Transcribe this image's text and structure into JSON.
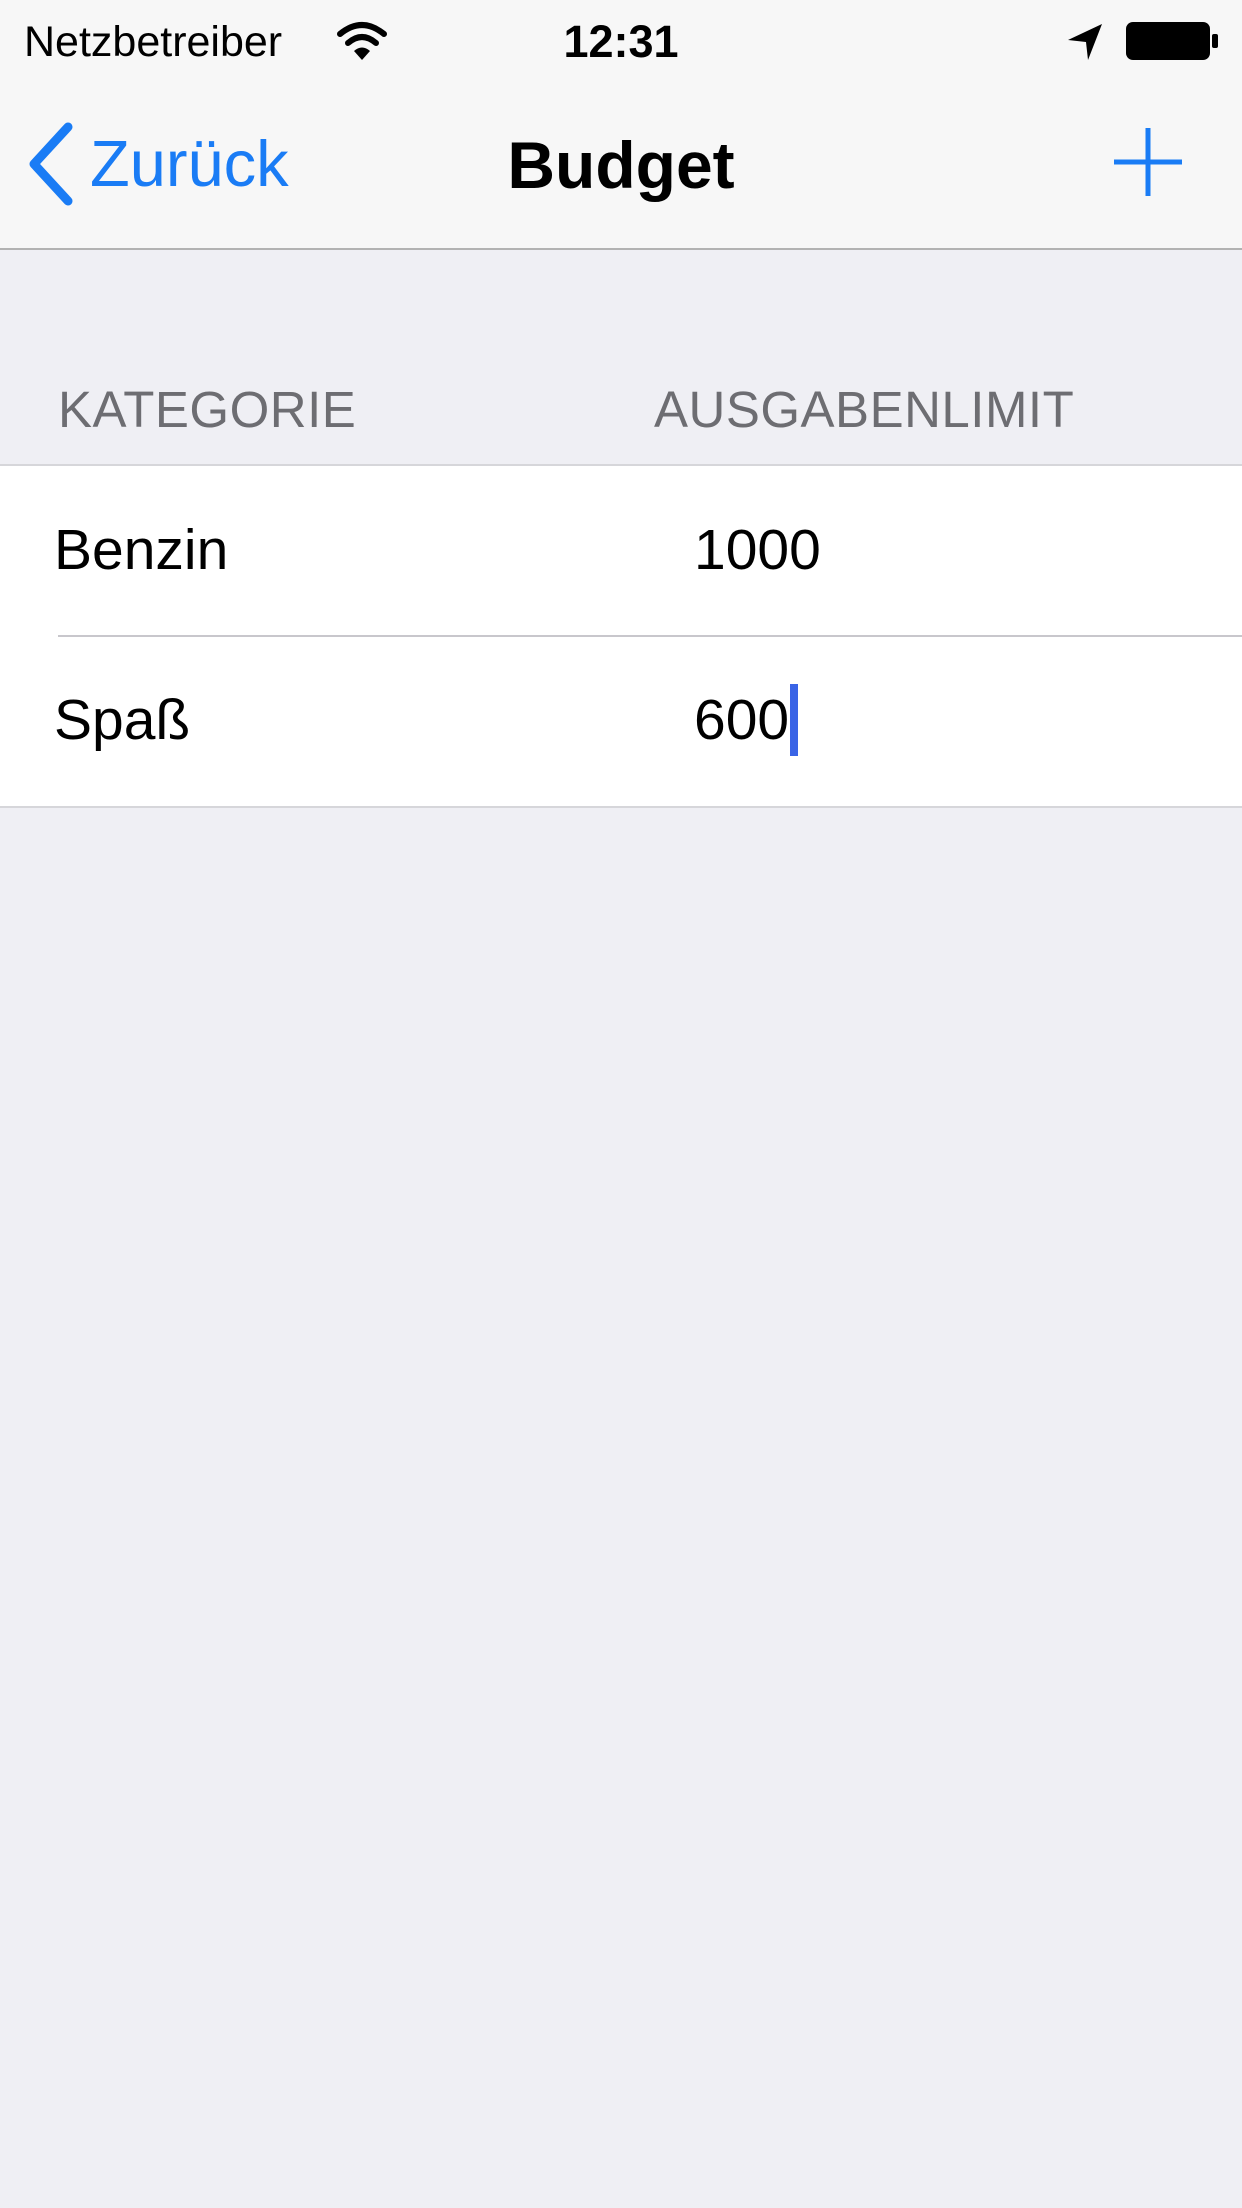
{
  "status_bar": {
    "carrier": "Netzbetreiber",
    "time": "12:31",
    "icons": [
      "wifi-icon",
      "location-arrow-icon",
      "battery-icon"
    ]
  },
  "nav_bar": {
    "back_label": "Zurück",
    "title": "Budget",
    "back_icon": "chevron-left-icon",
    "add_icon": "plus-icon"
  },
  "table": {
    "headers": [
      "KATEGORIE",
      "AUSGABENLIMIT"
    ],
    "rows": [
      {
        "category": "Benzin",
        "limit": "1000"
      },
      {
        "category": "Spaß",
        "limit": "600"
      }
    ],
    "active_row": 1
  },
  "colors": {
    "accent": "#1a7cf5",
    "background": "#efeff4",
    "bar_background": "#f7f7f7",
    "header_text": "#6d6d72",
    "caret": "#3a64e6"
  }
}
